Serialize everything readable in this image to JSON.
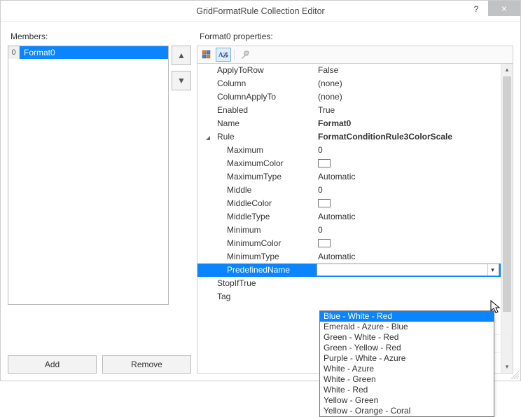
{
  "window": {
    "title": "GridFormatRule Collection Editor",
    "help_label": "?",
    "close_label": "×"
  },
  "left": {
    "members_label": "Members:",
    "items": [
      {
        "index": "0",
        "label": "Format0"
      }
    ],
    "move_up": "▲",
    "move_down": "▼",
    "add_label": "Add",
    "remove_label": "Remove"
  },
  "right": {
    "props_label": "Format0 properties:",
    "toolbar": {
      "categorized_icon": "categorized",
      "alpha_icon": "A↓",
      "wrench_icon": "🔧"
    },
    "rows": [
      {
        "name": "ApplyToRow",
        "value": "False",
        "indent": 1
      },
      {
        "name": "Column",
        "value": "(none)",
        "indent": 1
      },
      {
        "name": "ColumnApplyTo",
        "value": "(none)",
        "indent": 1
      },
      {
        "name": "Enabled",
        "value": "True",
        "indent": 1
      },
      {
        "name": "Name",
        "value": "Format0",
        "indent": 1,
        "bold": true
      },
      {
        "name": "Rule",
        "value": "FormatConditionRule3ColorScale",
        "indent": 1,
        "bold": true,
        "expand": true
      },
      {
        "name": "Maximum",
        "value": "0",
        "indent": 2
      },
      {
        "name": "MaximumColor",
        "value": "",
        "indent": 2,
        "color": true
      },
      {
        "name": "MaximumType",
        "value": "Automatic",
        "indent": 2
      },
      {
        "name": "Middle",
        "value": "0",
        "indent": 2
      },
      {
        "name": "MiddleColor",
        "value": "",
        "indent": 2,
        "color": true
      },
      {
        "name": "MiddleType",
        "value": "Automatic",
        "indent": 2
      },
      {
        "name": "Minimum",
        "value": "0",
        "indent": 2
      },
      {
        "name": "MinimumColor",
        "value": "",
        "indent": 2,
        "color": true
      },
      {
        "name": "MinimumType",
        "value": "Automatic",
        "indent": 2
      },
      {
        "name": "PredefinedName",
        "value": "",
        "indent": 2,
        "selected": true
      },
      {
        "name": "StopIfTrue",
        "value": "",
        "indent": 1
      },
      {
        "name": "Tag",
        "value": "",
        "indent": 1
      }
    ],
    "dropdown": [
      "Blue - White - Red",
      "Emerald - Azure - Blue",
      "Green - White - Red",
      "Green - Yellow - Red",
      "Purple - White - Azure",
      "White - Azure",
      "White - Green",
      "White - Red",
      "Yellow - Green",
      "Yellow - Orange - Coral"
    ]
  }
}
